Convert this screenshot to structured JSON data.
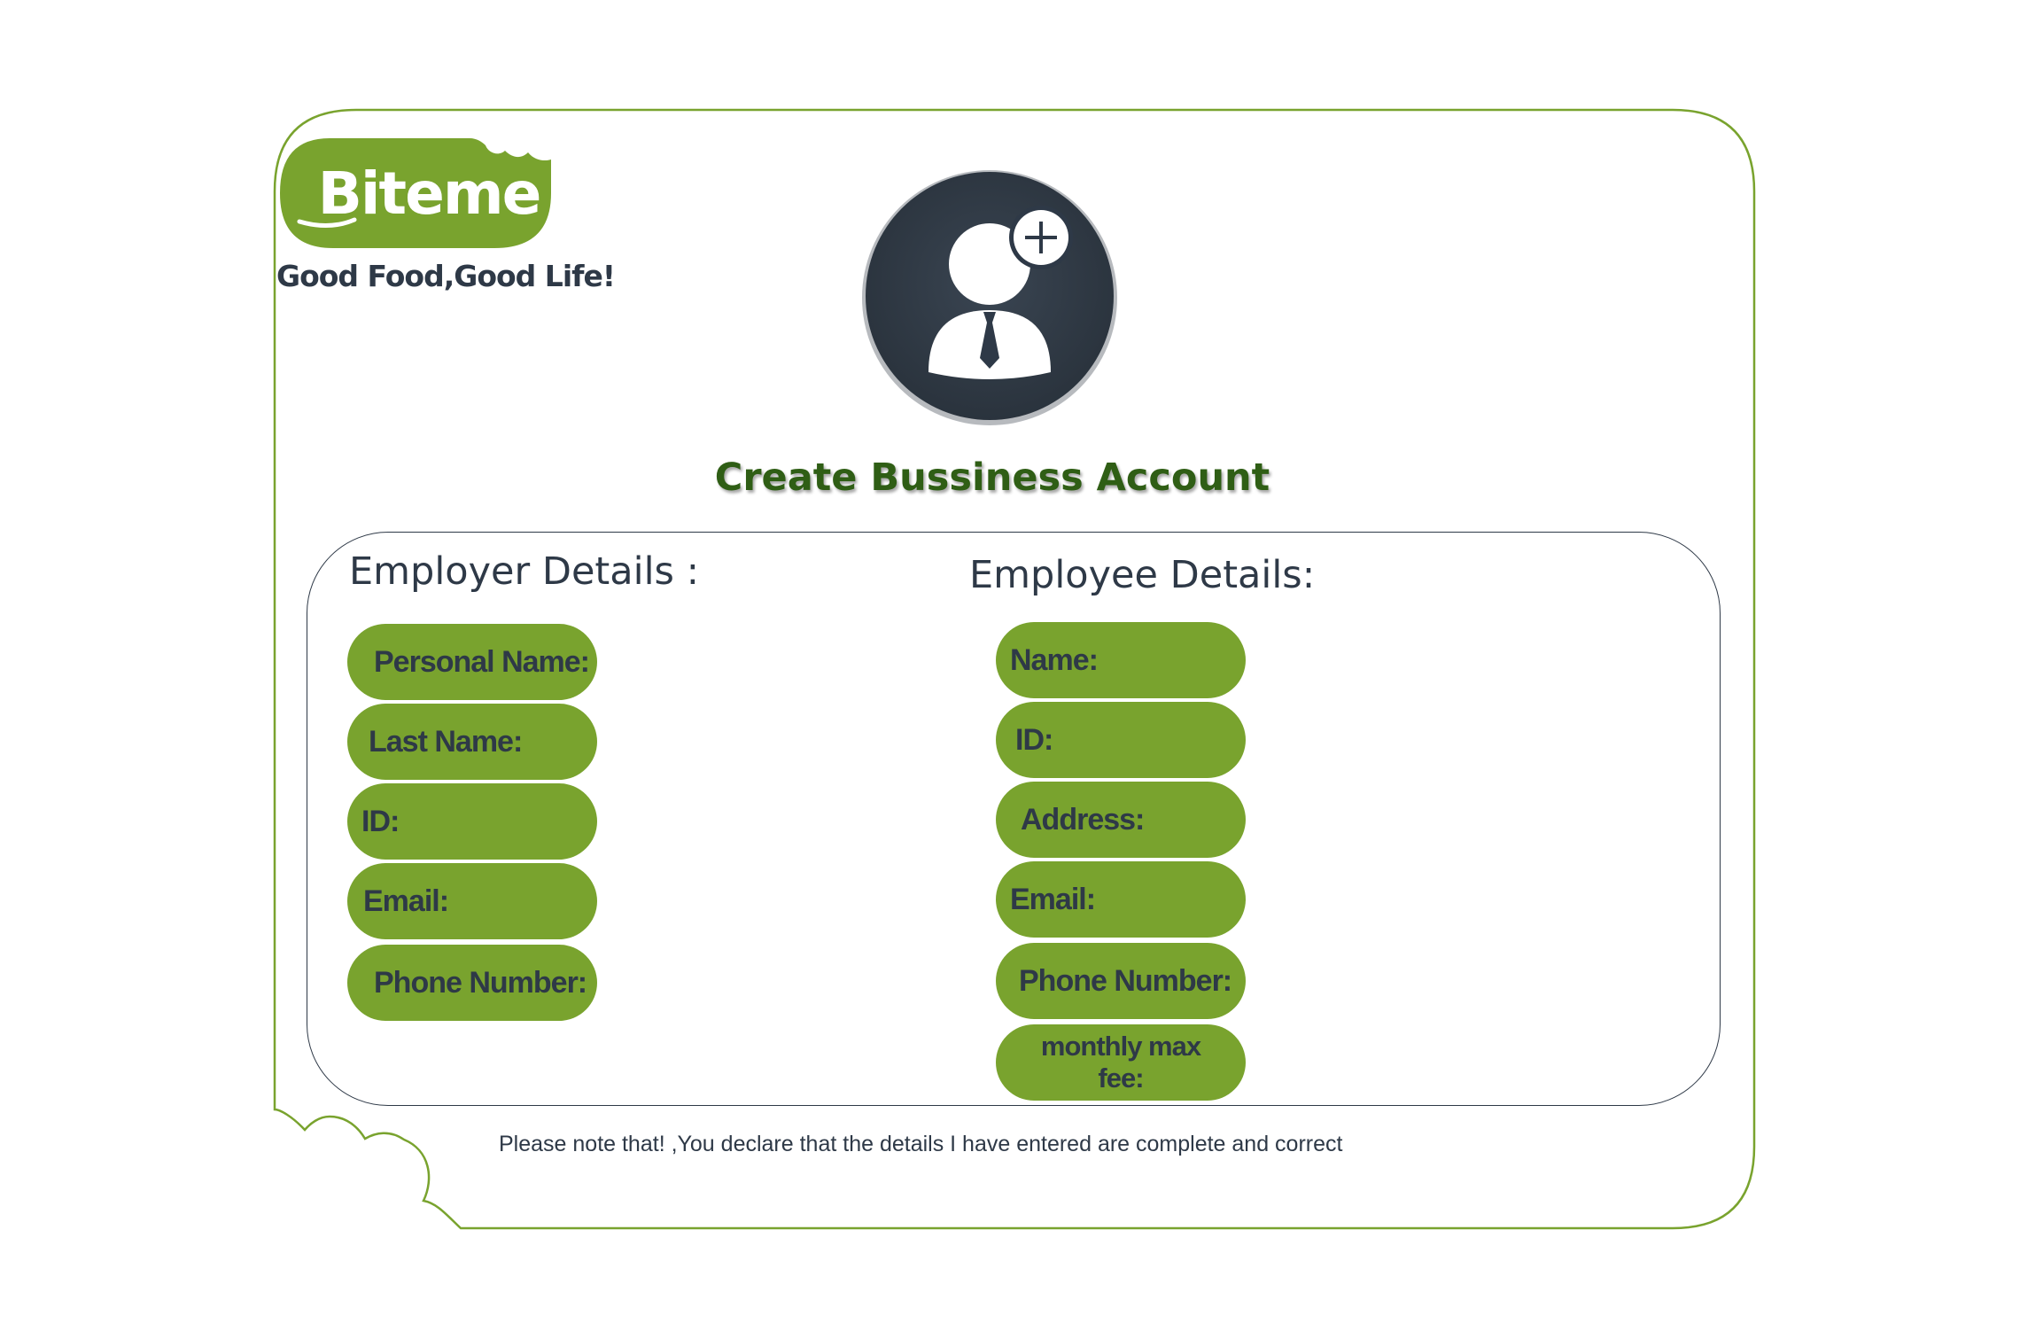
{
  "brand": {
    "logo_text": "Biteme",
    "tagline": "Good Food,Good Life!",
    "brand_color": "#79a32e",
    "text_color": "#2e3947"
  },
  "header": {
    "icon": "add-user-icon",
    "title": "Create Bussiness Account",
    "title_color": "#2f5e15"
  },
  "employer": {
    "title": "Employer Details :",
    "fields": [
      {
        "label": "Personal Name:"
      },
      {
        "label": "Last Name:"
      },
      {
        "label": "ID:"
      },
      {
        "label": "Email:"
      },
      {
        "label": "Phone Number:"
      }
    ]
  },
  "employee": {
    "title": "Employee Details:",
    "fields": [
      {
        "label": "Name:"
      },
      {
        "label": "ID:"
      },
      {
        "label": "Address:"
      },
      {
        "label": "Email:"
      },
      {
        "label": "Phone Number:"
      },
      {
        "label": "monthly max fee:"
      }
    ]
  },
  "footer": {
    "notice": "Please note that! ,You declare that the details I have entered are complete and correct"
  }
}
